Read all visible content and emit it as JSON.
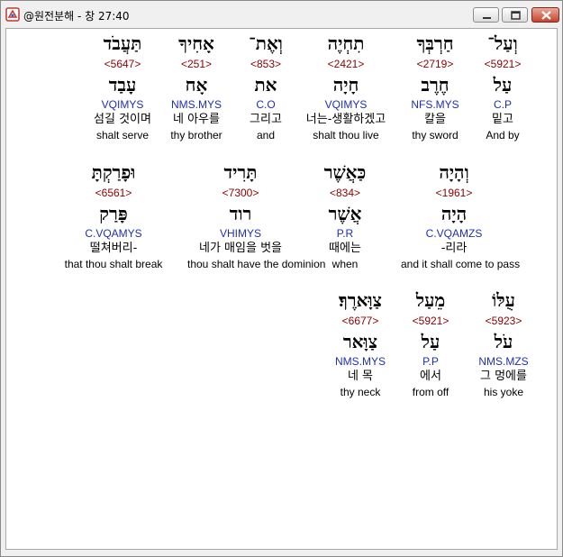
{
  "window": {
    "title": "@원전분해 - 창 27:40",
    "icon": "app-icon"
  },
  "rows": [
    {
      "words": [
        {
          "hebrew": "וְעַל־",
          "strong": "<5921>",
          "lemma": "עַל",
          "morph": "C.P",
          "korean": "밑고",
          "english": "And by",
          "highlight": true
        },
        {
          "hebrew": "חַרְבְּךָ",
          "strong": "<2719>",
          "lemma": "חֶרֶב",
          "morph": "NFS.MYS",
          "korean": "칼을",
          "english": "thy sword"
        },
        {
          "hebrew": "תִחְיֶה",
          "strong": "<2421>",
          "lemma": "חָיָה",
          "morph": "VQIMYS",
          "korean": "너는-생활하겠고",
          "english": "shalt thou live"
        },
        {
          "hebrew": "וְאֶת־",
          "strong": "<853>",
          "lemma": "את",
          "morph": "C.O",
          "korean": "그리고",
          "english": "and"
        },
        {
          "hebrew": "אָחִיךָ",
          "strong": "<251>",
          "lemma": "אָח",
          "morph": "NMS.MYS",
          "korean": "네 아우를",
          "english": "thy brother"
        },
        {
          "hebrew": "תַּעֲבֹד",
          "strong": "<5647>",
          "lemma": "עָבַד",
          "morph": "VQIMYS",
          "korean": "섬길 것이며",
          "english": "shalt serve"
        }
      ]
    },
    {
      "words": [
        {
          "hebrew": "וְהָיָה",
          "strong": "<1961>",
          "lemma": "הָיָה",
          "morph": "C.VQAMZS",
          "korean": "-리라",
          "english": "and it shall come to pass"
        },
        {
          "hebrew": "כַּאֲשֶׁר",
          "strong": "<834>",
          "lemma": "אֲשֶׁר",
          "morph": "P.R",
          "korean": "때에는",
          "english": "when"
        },
        {
          "hebrew": "תָּרִיד",
          "strong": "<7300>",
          "lemma": "רוד",
          "morph": "VHIMYS",
          "korean": "네가 매임을 벗을",
          "english": "thou shalt have the dominion"
        },
        {
          "hebrew": "וּפָרַקְתָּ",
          "strong": "<6561>",
          "lemma": "פָּרַק",
          "morph": "C.VQAMYS",
          "korean": "떨쳐버리-",
          "english": "that thou shalt break"
        }
      ]
    },
    {
      "words": [
        {
          "hebrew": "עֻלּוֹ",
          "strong": "<5923>",
          "lemma": "עֹל",
          "morph": "NMS.MZS",
          "korean": "그 멍에를",
          "english": "his yoke"
        },
        {
          "hebrew": "מֵעַל",
          "strong": "<5921>",
          "lemma": "עַל",
          "morph": "P.P",
          "korean": "에서",
          "english": "from off"
        },
        {
          "hebrew": "צַוָּארֶךָ׃",
          "strong": "<6677>",
          "lemma": "צַוָּאר",
          "morph": "NMS.MYS",
          "korean": "네 목",
          "english": "thy neck"
        }
      ]
    }
  ]
}
